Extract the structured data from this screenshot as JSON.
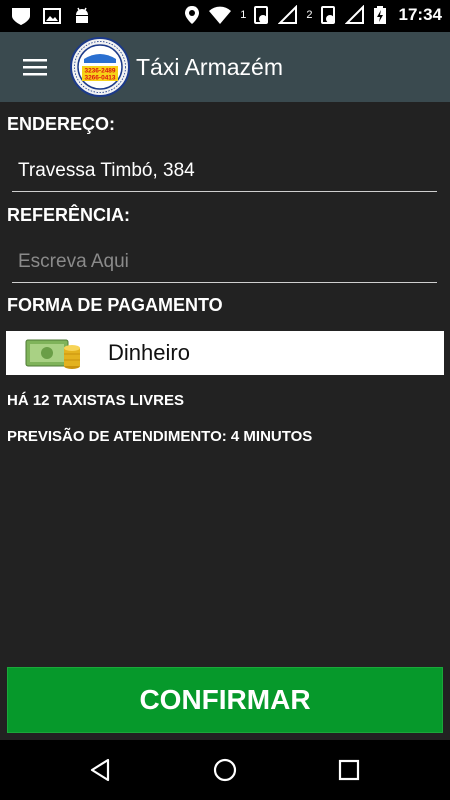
{
  "status_bar": {
    "time": "17:34",
    "sim1": "1",
    "sim2": "2",
    "icons": [
      "shield-icon",
      "image-icon",
      "android-icon",
      "location-icon",
      "wifi-icon",
      "signal-icon",
      "signal-icon",
      "battery-charging-icon"
    ]
  },
  "app_bar": {
    "title": "Táxi Armazém",
    "logo_phone_1": "3236-2489",
    "logo_phone_2": "3266-0413"
  },
  "form": {
    "address_label": "ENDEREÇO:",
    "address_value": "Travessa Timbó, 384",
    "reference_label": "REFERÊNCIA:",
    "reference_placeholder": "Escreva Aqui",
    "payment_label": "FORMA DE PAGAMENTO",
    "payment_value": "Dinheiro"
  },
  "info": {
    "drivers": "HÁ 12 TAXISTAS LIVRES",
    "eta": "PREVISÃO DE ATENDIMENTO: 4 MINUTOS"
  },
  "confirm_label": "CONFIRMAR",
  "colors": {
    "app_bar": "#3a4a4f",
    "background": "#222222",
    "confirm": "#06992b"
  }
}
